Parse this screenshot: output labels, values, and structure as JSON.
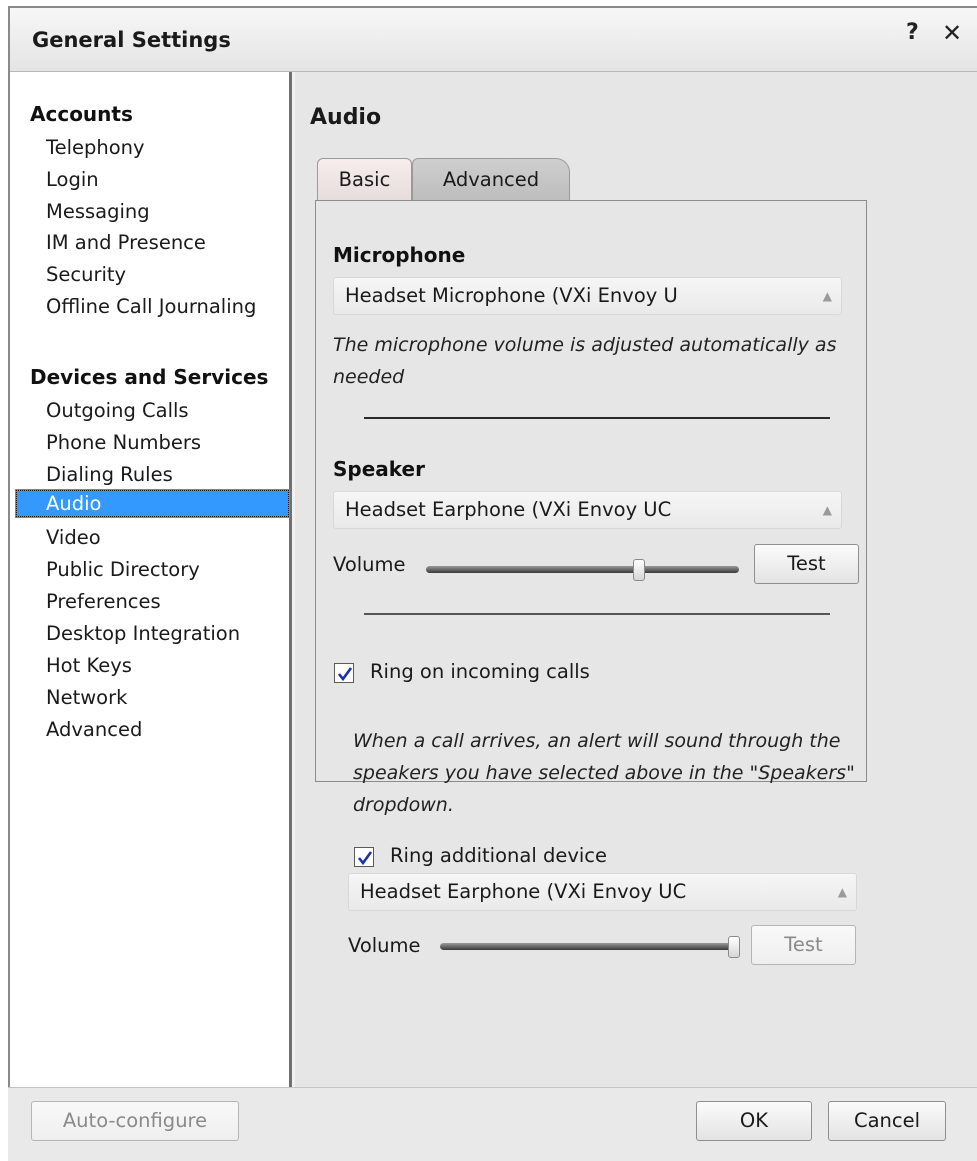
{
  "window": {
    "title": "General Settings",
    "help_label": "?",
    "close_label": "✕"
  },
  "sidebar": {
    "sections": [
      {
        "title": "Accounts",
        "items": [
          "Telephony",
          "Login",
          "Messaging",
          "IM and Presence",
          "Security",
          "Offline Call Journaling"
        ]
      },
      {
        "title": "Devices and Services",
        "items": [
          "Outgoing Calls",
          "Phone Numbers",
          "Dialing Rules",
          "Audio",
          "Video",
          "Public Directory",
          "Preferences",
          "Desktop Integration",
          "Hot Keys",
          "Network",
          "Advanced"
        ]
      }
    ],
    "selected": "Audio"
  },
  "main": {
    "heading": "Audio",
    "tabs": [
      {
        "label": "Basic",
        "active": true
      },
      {
        "label": "Advanced",
        "active": false
      }
    ],
    "microphone": {
      "label": "Microphone",
      "selected": "Headset Microphone (VXi Envoy U",
      "note": "The microphone volume is adjusted automatically as needed"
    },
    "speaker": {
      "label": "Speaker",
      "selected": "Headset Earphone (VXi Envoy UC",
      "volume_label": "Volume",
      "volume_level": 0.68,
      "test_label": "Test"
    },
    "ring": {
      "checkbox_label": "Ring on incoming calls",
      "checked": true,
      "note": "When a call arrives, an alert will sound through the speakers you have selected above in the \"Speakers\" dropdown.",
      "additional": {
        "checkbox_label": "Ring additional device",
        "checked": true,
        "selected": "Headset Earphone (VXi Envoy UC",
        "volume_label": "Volume",
        "volume_level": 0.99,
        "test_label": "Test",
        "test_enabled": false
      }
    }
  },
  "footer": {
    "autoconfigure_label": "Auto-configure",
    "ok_label": "OK",
    "cancel_label": "Cancel"
  },
  "colors": {
    "selection": "#3399ff",
    "panel_background": "#e6e6e6"
  }
}
